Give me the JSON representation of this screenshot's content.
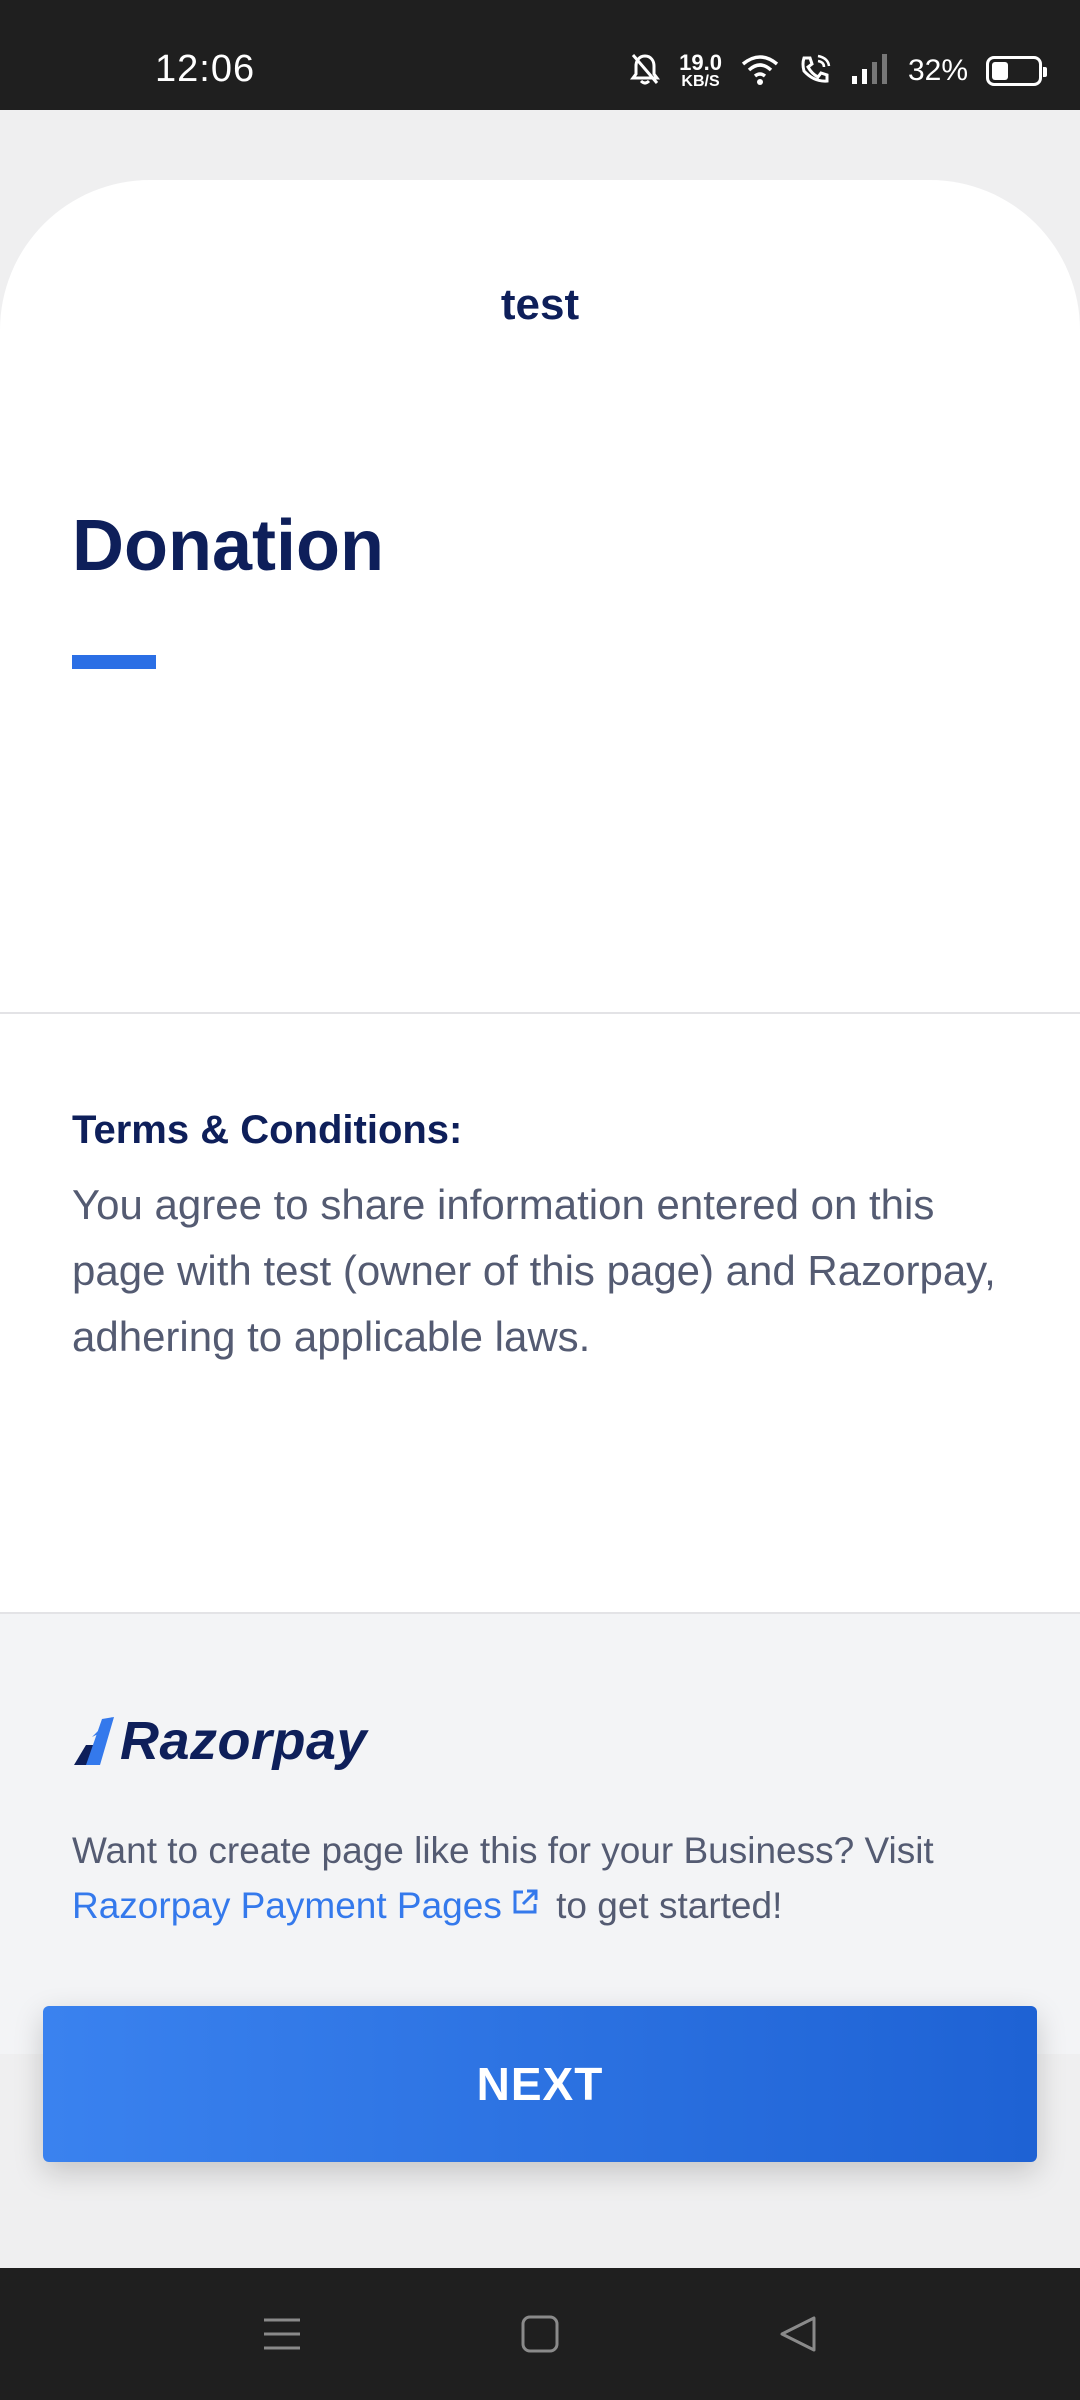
{
  "status_bar": {
    "time": "12:06",
    "net_speed_value": "19.0",
    "net_speed_unit": "KB/S",
    "battery_percent": "32%",
    "battery_level": 0.32
  },
  "card": {
    "title": "test",
    "heading": "Donation",
    "terms_label": "Terms & Conditions:",
    "terms_text": "You agree to share information entered on this page with test (owner of this page) and Razorpay, adhering to applicable laws."
  },
  "footer": {
    "logo_text": "Razorpay",
    "promo_before": "Want to create page like this for your Business? Visit ",
    "promo_link": "Razorpay Payment Pages",
    "promo_after": " to get started!"
  },
  "actions": {
    "next_label": "NEXT"
  },
  "colors": {
    "primary": "#2b6fe5",
    "heading": "#0e1f5a",
    "text": "#545b72",
    "link": "#3479ec"
  },
  "icons": [
    "bell-off-icon",
    "wifi-icon",
    "wifi-call-icon",
    "signal-icon",
    "battery-icon",
    "external-link-icon",
    "menu-icon",
    "home-icon",
    "back-icon"
  ]
}
